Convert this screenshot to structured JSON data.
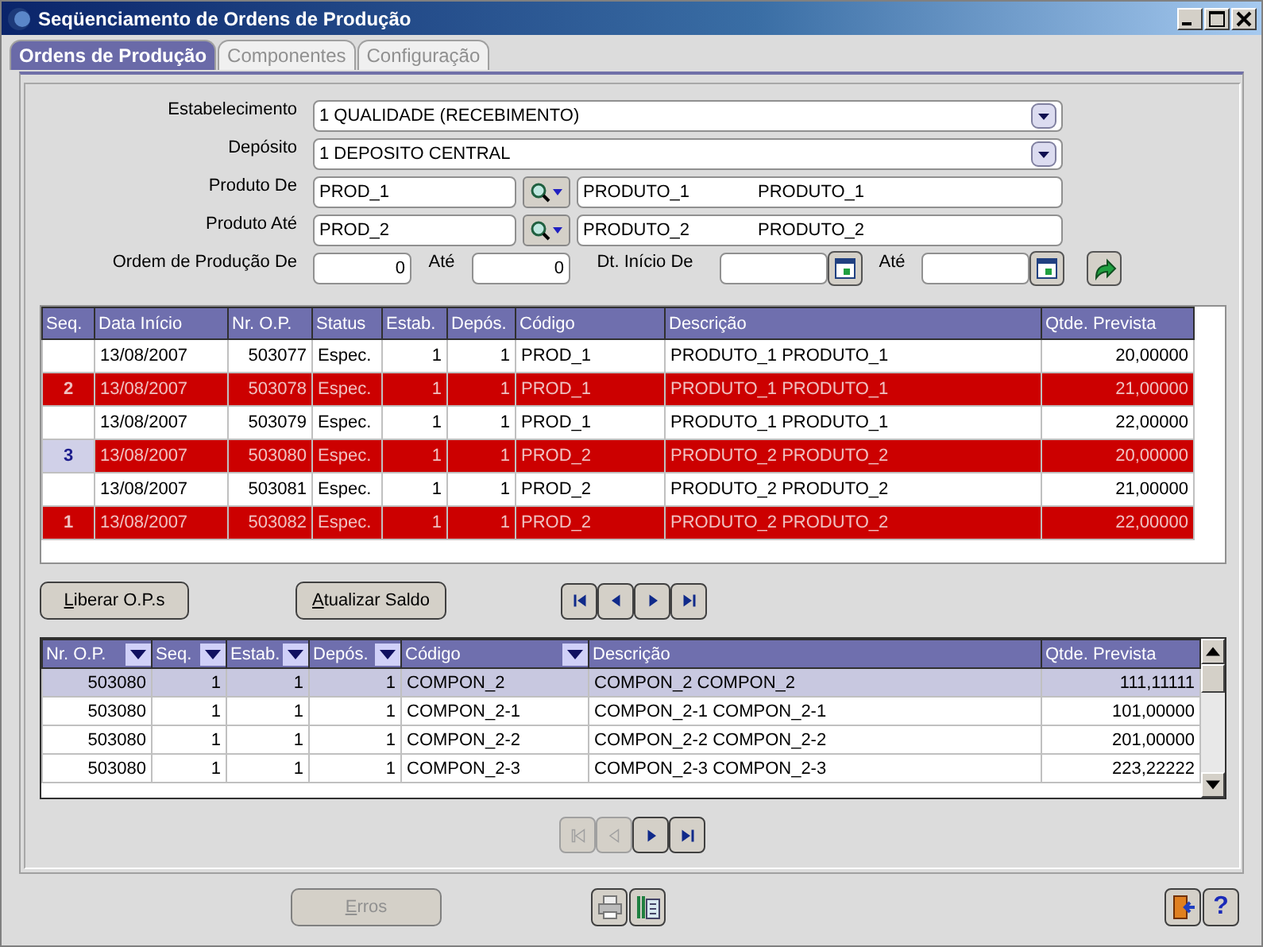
{
  "window": {
    "title": "Seqüenciamento de Ordens de Produção"
  },
  "tabs": [
    {
      "label": "Ordens de Produção",
      "selected": true
    },
    {
      "label": "Componentes",
      "selected": false
    },
    {
      "label": "Configuração",
      "selected": false
    }
  ],
  "form": {
    "estabelecimento": {
      "label": "Estabelecimento",
      "value": "1 QUALIDADE (RECEBIMENTO)"
    },
    "deposito": {
      "label": "Depósito",
      "value": "1 DEPOSITO CENTRAL"
    },
    "produto_de": {
      "label": "Produto De",
      "code": "PROD_1",
      "name": "PRODUTO_1",
      "description": "PRODUTO_1"
    },
    "produto_ate": {
      "label": "Produto Até",
      "code": "PROD_2",
      "name": "PRODUTO_2",
      "description": "PRODUTO_2"
    },
    "ordem_de": {
      "label": "Ordem de Produção De",
      "value": "0"
    },
    "ordem_ate": {
      "label": "Até",
      "value": "0"
    },
    "data_de": {
      "label": "Dt. Início De"
    },
    "data_ate": {
      "label": "Até"
    }
  },
  "orders": {
    "columns": [
      "Seq.",
      "Data Início",
      "Nr. O.P.",
      "Status",
      "Estab.",
      "Depós.",
      "Código",
      "Descrição",
      "Qtde. Prevista"
    ],
    "rows": [
      {
        "marked": false,
        "selected": false,
        "cells": [
          "",
          "13/08/2007",
          "503077",
          "Espec.",
          "1",
          "1",
          "PROD_1",
          "PRODUTO_1 PRODUTO_1",
          "20,00000"
        ]
      },
      {
        "marked": true,
        "selected": false,
        "cells": [
          "2",
          "13/08/2007",
          "503078",
          "Espec.",
          "1",
          "1",
          "PROD_1",
          "PRODUTO_1 PRODUTO_1",
          "21,00000"
        ]
      },
      {
        "marked": false,
        "selected": false,
        "cells": [
          "",
          "13/08/2007",
          "503079",
          "Espec.",
          "1",
          "1",
          "PROD_1",
          "PRODUTO_1 PRODUTO_1",
          "22,00000"
        ]
      },
      {
        "marked": true,
        "selected": true,
        "cells": [
          "3",
          "13/08/2007",
          "503080",
          "Espec.",
          "1",
          "1",
          "PROD_2",
          "PRODUTO_2 PRODUTO_2",
          "20,00000"
        ]
      },
      {
        "marked": false,
        "selected": false,
        "cells": [
          "",
          "13/08/2007",
          "503081",
          "Espec.",
          "1",
          "1",
          "PROD_2",
          "PRODUTO_2 PRODUTO_2",
          "21,00000"
        ]
      },
      {
        "marked": true,
        "selected": false,
        "cells": [
          "1",
          "13/08/2007",
          "503082",
          "Espec.",
          "1",
          "1",
          "PROD_2",
          "PRODUTO_2 PRODUTO_2",
          "22,00000"
        ]
      }
    ]
  },
  "actions": [
    {
      "label": "Liberar O.P.s"
    },
    {
      "label": "Atualizar Saldo"
    }
  ],
  "orders_nav": [
    {
      "kind": "first",
      "disabled": false
    },
    {
      "kind": "prev",
      "disabled": false
    },
    {
      "kind": "next",
      "disabled": false
    },
    {
      "kind": "last",
      "disabled": false
    }
  ],
  "components": {
    "columns": [
      {
        "label": "Nr. O.P.",
        "filter": true
      },
      {
        "label": "Seq.",
        "filter": true
      },
      {
        "label": "Estab.",
        "filter": true
      },
      {
        "label": "Depós.",
        "filter": true
      },
      {
        "label": "Código",
        "filter": true
      },
      {
        "label": "Descrição",
        "filter": false
      },
      {
        "label": "Qtde. Prevista",
        "filter": false
      }
    ],
    "rows": [
      {
        "selected": true,
        "cells": [
          "503080",
          "1",
          "1",
          "1",
          "COMPON_2",
          "COMPON_2 COMPON_2",
          "111,11111"
        ]
      },
      {
        "selected": false,
        "cells": [
          "503080",
          "1",
          "1",
          "1",
          "COMPON_2-1",
          "COMPON_2-1 COMPON_2-1",
          "101,00000"
        ]
      },
      {
        "selected": false,
        "cells": [
          "503080",
          "1",
          "1",
          "1",
          "COMPON_2-2",
          "COMPON_2-2 COMPON_2-2",
          "201,00000"
        ]
      },
      {
        "selected": false,
        "cells": [
          "503080",
          "1",
          "1",
          "1",
          "COMPON_2-3",
          "COMPON_2-3 COMPON_2-3",
          "223,22222"
        ]
      }
    ]
  },
  "components_nav": [
    {
      "kind": "first",
      "disabled": true
    },
    {
      "kind": "prev",
      "disabled": true
    },
    {
      "kind": "next",
      "disabled": false
    },
    {
      "kind": "last",
      "disabled": false
    }
  ],
  "footer": {
    "errors_button": {
      "label": "Erros",
      "disabled": true
    },
    "help_label": "?"
  }
}
